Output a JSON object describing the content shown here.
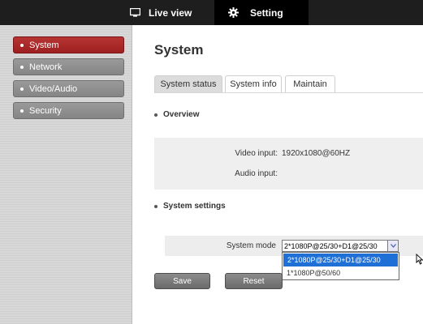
{
  "topnav": {
    "live_view": "Live view",
    "setting": "Setting"
  },
  "sidebar": {
    "items": [
      {
        "label": "System",
        "active": true
      },
      {
        "label": "Network",
        "active": false
      },
      {
        "label": "Video/Audio",
        "active": false
      },
      {
        "label": "Security",
        "active": false
      }
    ]
  },
  "page": {
    "title": "System"
  },
  "tabs": [
    {
      "label": "System status"
    },
    {
      "label": "System info"
    },
    {
      "label": "Maintain"
    }
  ],
  "overview": {
    "heading": "Overview",
    "video_input_label": "Video input:",
    "video_input_value": "1920x1080@60HZ",
    "audio_input_label": "Audio input:",
    "audio_input_value": ""
  },
  "system_settings": {
    "heading": "System settings",
    "mode_label": "System mode",
    "mode_value": "2*1080P@25/30+D1@25/30",
    "options": [
      "2*1080P@25/30+D1@25/30",
      "1*1080P@50/60"
    ]
  },
  "buttons": {
    "save": "Save",
    "reset": "Reset"
  },
  "colors": {
    "active_red": "#a82626",
    "topbar": "#1e1e1e",
    "selection_blue": "#1f70d6"
  }
}
